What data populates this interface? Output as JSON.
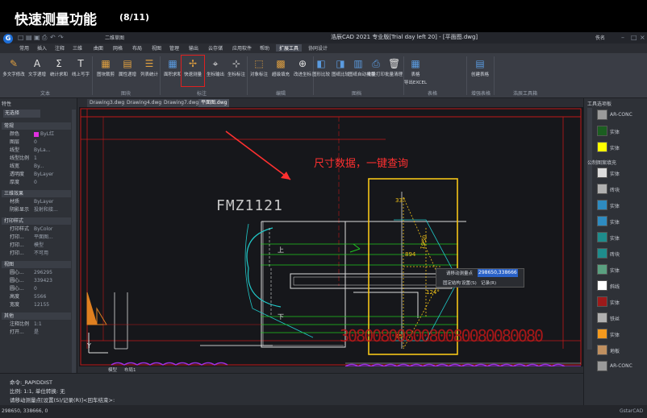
{
  "banner": {
    "title": "快速测量功能",
    "page": "(8/11)"
  },
  "window": {
    "title": "浩辰CAD 2021 专业版[Trial day left 20] - [平面图.dwg]",
    "logo": "G",
    "view_label": "二维草图",
    "user_label": "佚名"
  },
  "ribbon_tabs": [
    {
      "label": "常用"
    },
    {
      "label": "插入"
    },
    {
      "label": "注释"
    },
    {
      "label": "三维"
    },
    {
      "label": "曲面"
    },
    {
      "label": "网格"
    },
    {
      "label": "布局"
    },
    {
      "label": "视图"
    },
    {
      "label": "管理"
    },
    {
      "label": "输出"
    },
    {
      "label": "云存储"
    },
    {
      "label": "应用软件"
    },
    {
      "label": "帮助"
    },
    {
      "label": "扩展工具"
    },
    {
      "label": "协同设计"
    }
  ],
  "ribbon_buttons": [
    {
      "label": "多文字修改"
    },
    {
      "label": "文字递增"
    },
    {
      "label": "统计求和"
    },
    {
      "label": "线上写字"
    },
    {
      "label": "图块裁剪"
    },
    {
      "label": "属性递增"
    },
    {
      "label": "列表统计"
    },
    {
      "label": "面积求和"
    },
    {
      "label": "快速测量"
    },
    {
      "label": "坐标输出"
    },
    {
      "label": "坐标标注"
    },
    {
      "label": "对象标注"
    },
    {
      "label": "超级填充"
    },
    {
      "label": "改进坐标"
    },
    {
      "label": "图形比较"
    },
    {
      "label": "图纸比较"
    },
    {
      "label": "图纸自动排版"
    },
    {
      "label": "批量打印"
    },
    {
      "label": "批量清理"
    },
    {
      "label": "表格"
    },
    {
      "label": "导出EXCEL"
    },
    {
      "label": "创建表格"
    }
  ],
  "ribbon_groups": [
    {
      "label": "文本"
    },
    {
      "label": "图块"
    },
    {
      "label": "标注"
    },
    {
      "label": "编辑"
    },
    {
      "label": "图档"
    },
    {
      "label": "表格"
    },
    {
      "label": "增强表格"
    },
    {
      "label": "浩辰工具箱"
    }
  ],
  "doc_tabs": [
    {
      "label": "Drawing3.dwg"
    },
    {
      "label": "Drawing4.dwg"
    },
    {
      "label": "Drawing7.dwg"
    },
    {
      "label": "平面图.dwg"
    }
  ],
  "properties": {
    "title": "特性",
    "selection": "无选择",
    "sections": [
      {
        "label": "常规",
        "rows": [
          {
            "k": "颜色",
            "v": "ByL红"
          },
          {
            "k": "图层",
            "v": "0"
          },
          {
            "k": "线型",
            "v": "ByLa..."
          },
          {
            "k": "线型比例",
            "v": "1"
          },
          {
            "k": "线宽",
            "v": "By..."
          },
          {
            "k": "透明度",
            "v": "ByLayer"
          },
          {
            "k": "厚度",
            "v": "0"
          }
        ]
      },
      {
        "label": "三维效果",
        "rows": [
          {
            "k": "材质",
            "v": "ByLayer"
          },
          {
            "k": "阴影显示",
            "v": "投射和接..."
          }
        ]
      },
      {
        "label": "打印样式",
        "rows": [
          {
            "k": "打印样式",
            "v": "ByColor"
          },
          {
            "k": "打印...",
            "v": "平面图..."
          },
          {
            "k": "打印...",
            "v": "模型"
          },
          {
            "k": "打印...",
            "v": "不可用"
          }
        ]
      },
      {
        "label": "视图",
        "rows": [
          {
            "k": "圆心...",
            "v": "296295"
          },
          {
            "k": "圆心...",
            "v": "339423"
          },
          {
            "k": "圆心...",
            "v": "0"
          },
          {
            "k": "高度",
            "v": "5566"
          },
          {
            "k": "宽度",
            "v": "12155"
          }
        ]
      },
      {
        "label": "其他",
        "rows": [
          {
            "k": "注释比例",
            "v": "1:1"
          },
          {
            "k": "打开...",
            "v": "是"
          }
        ]
      }
    ]
  },
  "canvas": {
    "annotation": "尺寸数据，一键查询",
    "text_fm": "FMZ1121",
    "text_up": "上",
    "text_down": "下",
    "angle_33": "33°",
    "angle_124": "124°",
    "angle_45": "45°",
    "dim_894": "894",
    "dim_1950": "1950",
    "overlap_text": "3080080080080080080080080",
    "popup": {
      "label": "请移动测量点",
      "value": "298650,338666",
      "options": [
        {
          "label": "固定结构"
        },
        {
          "label": "设置(S)"
        },
        {
          "label": "记录(R)"
        }
      ]
    },
    "colors": {
      "annotation_red": "#ff3030",
      "highlight_yellow": "#f5c518",
      "cyan_line": "#20c8c8",
      "green_line": "#20c820"
    }
  },
  "layout_tabs": [
    {
      "label": "模型"
    },
    {
      "label": "布局1"
    }
  ],
  "command_lines": [
    {
      "text": "命令:_RAPIDDIST"
    },
    {
      "text": "比例: 1:1, 单位转换: 无"
    },
    {
      "text": "请移动测量点[设置(S)/记录(R)]<回车结束>:"
    }
  ],
  "status": {
    "coords": "298650, 338666, 0",
    "brand": "GstarCAD"
  },
  "tool_panel": {
    "title": "工具选项板",
    "items": [
      {
        "label": "AR-CONC",
        "color": "#9a9a9a"
      },
      {
        "label": "实体",
        "color": "#1b5e20"
      },
      {
        "label": "实体",
        "color": "#ffff00"
      },
      {
        "label": "公制图案填充",
        "color": ""
      },
      {
        "label": "实体",
        "color": "#dcdcdc"
      },
      {
        "label": "砖块",
        "color": "#b0b0b0"
      },
      {
        "label": "实体",
        "color": "#2e8bc0"
      },
      {
        "label": "实体",
        "color": "#2e8bc0"
      },
      {
        "label": "实体",
        "color": "#1e8c8c"
      },
      {
        "label": "砖块",
        "color": "#1e8c8c"
      },
      {
        "label": "实体",
        "color": "#5aa080"
      },
      {
        "label": "斜线",
        "color": "#ffffff"
      },
      {
        "label": "实体",
        "color": "#9c1a1a"
      },
      {
        "label": "铁丝",
        "color": "#b0b0b0"
      },
      {
        "label": "实体",
        "color": "#f59a1e"
      },
      {
        "label": "地板",
        "color": "#c09060"
      },
      {
        "label": "AR-CONC",
        "color": "#9a9a9a"
      }
    ]
  }
}
